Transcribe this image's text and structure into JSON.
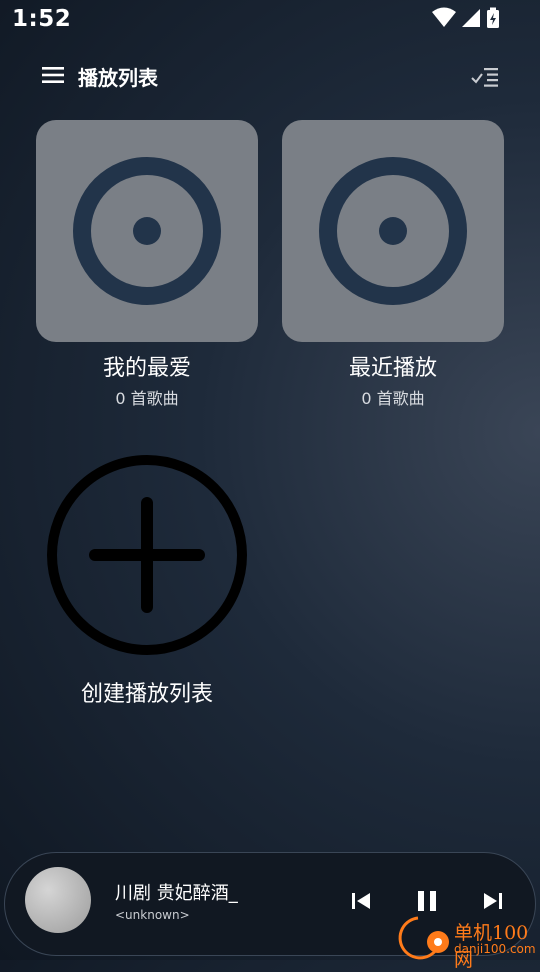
{
  "status_bar": {
    "time": "1:52",
    "icons": [
      "wifi-icon",
      "signal-icon",
      "battery-charging-icon"
    ]
  },
  "header": {
    "title": "播放列表",
    "left_icon": "menu-icon",
    "right_icon": "sort-checklist-icon"
  },
  "playlists": [
    {
      "title": "我的最爱",
      "count": "0 首歌曲",
      "icon": "disc-icon"
    },
    {
      "title": "最近播放",
      "count": "0 首歌曲",
      "icon": "disc-icon"
    }
  ],
  "create_playlist": {
    "label": "创建播放列表",
    "icon": "add-circle-icon"
  },
  "mini_player": {
    "track_title": "川剧 贵妃醉酒_",
    "artist": "<unknown>",
    "controls": [
      "skip-previous-icon",
      "pause-icon",
      "skip-next-icon"
    ]
  },
  "watermark": {
    "text": "单机100网",
    "url_text": "danji100.com"
  },
  "colors": {
    "tile_bg": "#7a7f86",
    "disc_ring": "#22344a",
    "player_bg": "#111822",
    "watermark": "#ff7b1a"
  }
}
